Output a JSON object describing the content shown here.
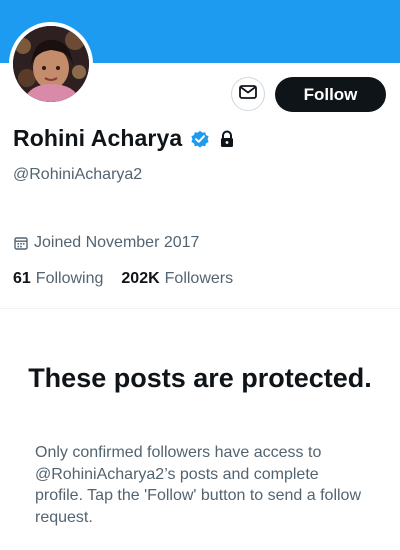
{
  "profile": {
    "name": "Rohini Acharya",
    "handle": "@RohiniAcharya2",
    "joined": "Joined November 2017",
    "following_count": "61",
    "following_label": "Following",
    "followers_count": "202K",
    "followers_label": "Followers"
  },
  "actions": {
    "follow_label": "Follow"
  },
  "protected": {
    "title": "These posts are protected.",
    "body": "Only confirmed followers have access to @RohiniAcharya2’s posts and complete profile. Tap the 'Follow' button to send a follow request."
  },
  "colors": {
    "banner": "#1d9bf0",
    "verified": "#1d9bf0",
    "primary_text": "#0f1419",
    "secondary_text": "#536471",
    "follow_button": "#0f1419"
  },
  "icons": [
    "mail-icon",
    "verified-badge-icon",
    "lock-icon",
    "calendar-icon"
  ]
}
